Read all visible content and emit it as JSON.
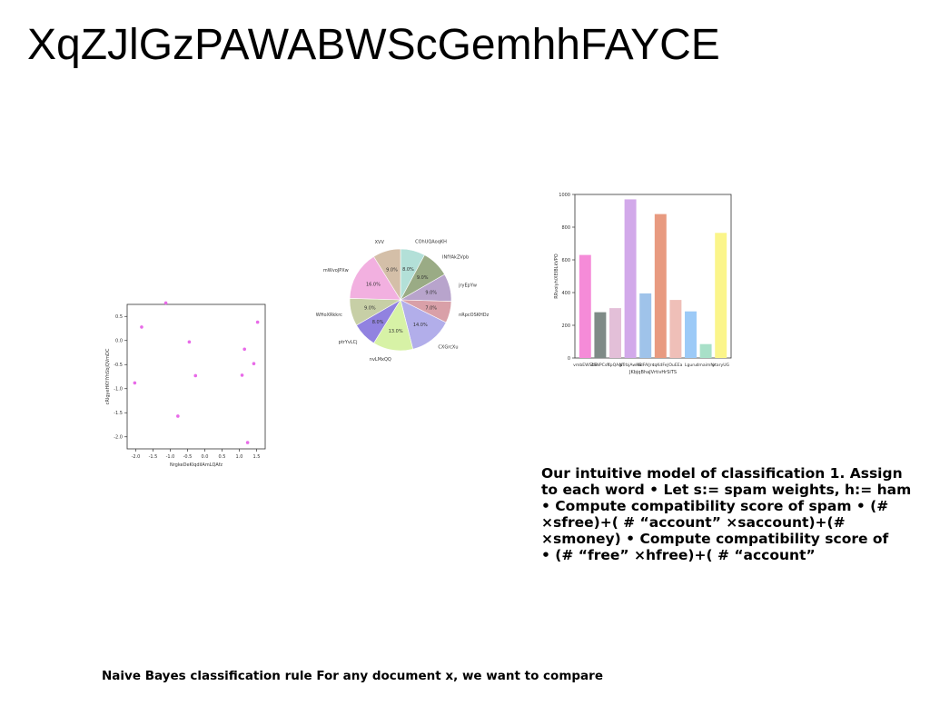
{
  "slide": {
    "title": "XqZJlGzPAWABWScGemhhFAYCE",
    "body_lines": [
      "Our intuitive model of classification 1. Assign",
      "to each word • Let s:= spam weights, h:= ham",
      "• Compute compatibility score of spam • (#",
      "×sfree)+( # “account” ×saccount)+(#",
      "×smoney) • Compute compatibility score of",
      "• (# “free” ×hfree)+( # “account”"
    ],
    "footer": "Naive Bayes classification rule For any document x, we want to compare"
  },
  "chart_data": [
    {
      "type": "scatter",
      "xlabel": "NrgkeDeKlqdiIAmLQAfz",
      "ylabel": "cRIgyeHKYlYhSbjQVmDC",
      "xlim": [
        -2.25,
        1.75
      ],
      "ylim": [
        -2.25,
        0.75
      ],
      "xticks": [
        "-2.0",
        "-1.5",
        "-1.0",
        "-0.5",
        "0.0",
        "0.5",
        "1.0",
        "1.5"
      ],
      "yticks": [
        "0.5",
        "0.0",
        "-0.5",
        "-1.0",
        "-1.5",
        "-2.0"
      ],
      "point_color": "#e86ae8",
      "points": [
        {
          "x": -2.03,
          "y": -0.88
        },
        {
          "x": -1.83,
          "y": 0.28
        },
        {
          "x": -1.13,
          "y": 0.78
        },
        {
          "x": -0.78,
          "y": -1.57
        },
        {
          "x": -0.45,
          "y": -0.03
        },
        {
          "x": -0.27,
          "y": -0.73
        },
        {
          "x": 1.08,
          "y": -0.72
        },
        {
          "x": 1.15,
          "y": -0.18
        },
        {
          "x": 1.24,
          "y": -2.12
        },
        {
          "x": 1.42,
          "y": -0.48
        },
        {
          "x": 1.53,
          "y": 0.38
        }
      ]
    },
    {
      "type": "pie",
      "slices": [
        {
          "label": "COhUQAoqKH",
          "value": 8.0,
          "pct": "8.0%",
          "color": "#b3e0d8"
        },
        {
          "label": "INfYAkZVpb",
          "value": 9.0,
          "pct": "9.0%",
          "color": "#9aab85"
        },
        {
          "label": "jryEpYw",
          "value": 9.0,
          "pct": "9.0%",
          "color": "#b8a4cc"
        },
        {
          "label": "nRpcOSKHDz",
          "value": 7.0,
          "pct": "7.0%",
          "color": "#d9a0a8"
        },
        {
          "label": "CXGrcXu",
          "value": 14.0,
          "pct": "14.0%",
          "color": "#b2aeea"
        },
        {
          "label": "nvLMxQQ",
          "value": 13.0,
          "pct": "13.0%",
          "color": "#d7f2a6"
        },
        {
          "label": "ptrYvLCj",
          "value": 8.0,
          "pct": "8.0%",
          "color": "#9182e0"
        },
        {
          "label": "WHoXRkkrc",
          "value": 9.0,
          "pct": "9.0%",
          "color": "#c7cfa6"
        },
        {
          "label": "mWvoJPXw",
          "value": 16.0,
          "pct": "16.0%",
          "color": "#f2b0e0"
        },
        {
          "label": "XVV",
          "value": 9.0,
          "pct": "9.0%",
          "color": "#d4bfa8"
        }
      ]
    },
    {
      "type": "bar",
      "xlabel": "JKbjqBhaJVrtivHrSiTS",
      "ylabel": "RRvoiyhiXEIBLkVPO",
      "ylim": [
        0,
        1000
      ],
      "yticks": [
        "0",
        "200",
        "400",
        "600",
        "800",
        "1000"
      ],
      "categories": [
        "vmbEWSbS",
        "ZSNPCsR",
        "YpQAgr",
        "NTrbjAwHS",
        "NdFAlJrs",
        "tqKdFeJ",
        "OuEEa",
        "Lguru",
        "dmaimNr",
        "ytaryUG"
      ],
      "values": [
        630,
        280,
        305,
        970,
        395,
        880,
        355,
        285,
        85,
        765
      ],
      "colors": [
        "#f58bd8",
        "#7f8b87",
        "#e3bfd8",
        "#d2a9ea",
        "#9fc3ea",
        "#e89a80",
        "#efbfb8",
        "#9ccaf7",
        "#a8e0c8",
        "#fbf58a"
      ]
    }
  ]
}
